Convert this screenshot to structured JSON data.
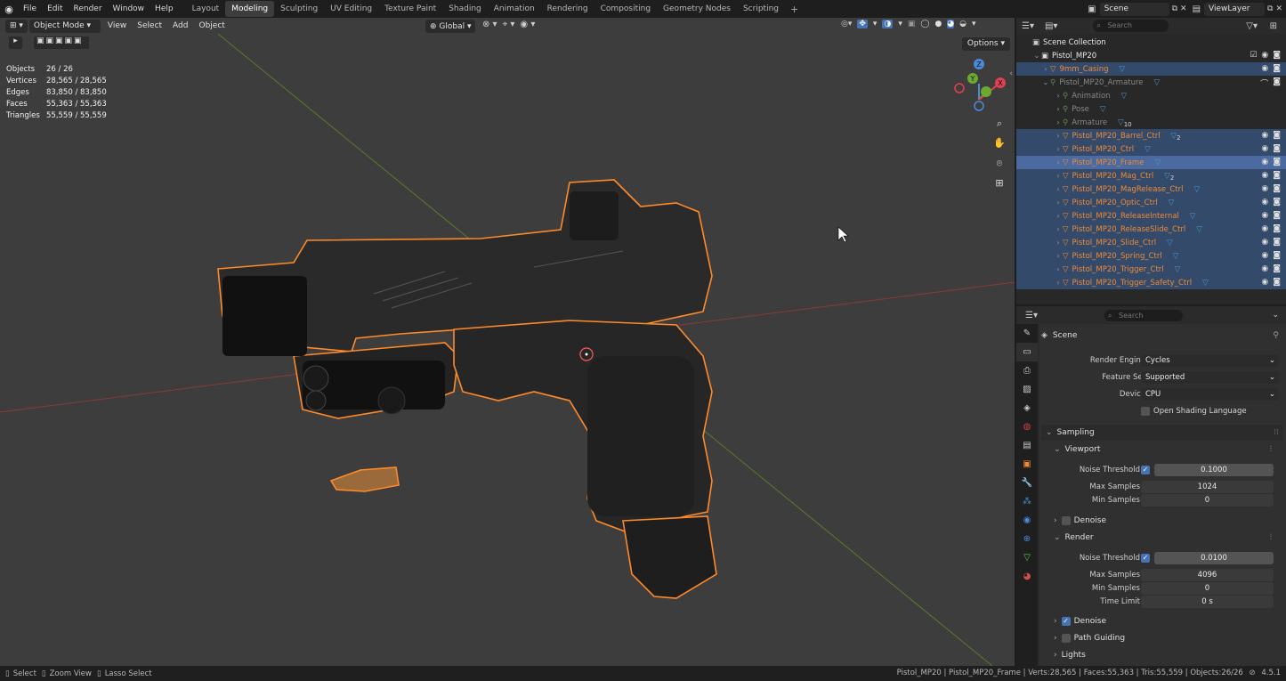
{
  "menu": [
    "File",
    "Edit",
    "Render",
    "Window",
    "Help"
  ],
  "workspaces": [
    {
      "label": "Layout",
      "active": false
    },
    {
      "label": "Modeling",
      "active": true
    },
    {
      "label": "Sculpting",
      "active": false
    },
    {
      "label": "UV Editing",
      "active": false
    },
    {
      "label": "Texture Paint",
      "active": false
    },
    {
      "label": "Shading",
      "active": false
    },
    {
      "label": "Animation",
      "active": false
    },
    {
      "label": "Rendering",
      "active": false
    },
    {
      "label": "Compositing",
      "active": false
    },
    {
      "label": "Geometry Nodes",
      "active": false
    },
    {
      "label": "Scripting",
      "active": false
    }
  ],
  "top_right": {
    "scene": "Scene",
    "view_layer": "ViewLayer"
  },
  "viewport": {
    "mode": "Object Mode",
    "menus": [
      "View",
      "Select",
      "Add",
      "Object"
    ],
    "orientation": "Global",
    "options": "Options",
    "gizmo": {
      "x": "X",
      "y": "Y",
      "z": "Z"
    }
  },
  "stats": [
    {
      "key": "Objects",
      "value": "26 / 26"
    },
    {
      "key": "Vertices",
      "value": "28,565 / 28,565"
    },
    {
      "key": "Edges",
      "value": "83,850 / 83,850"
    },
    {
      "key": "Faces",
      "value": "55,363 / 55,363"
    },
    {
      "key": "Triangles",
      "value": "55,559 / 55,559"
    }
  ],
  "outliner": {
    "search_placeholder": "Search",
    "root": "Scene Collection",
    "collection": "Pistol_MP20",
    "rows": [
      {
        "label": "9mm_Casing",
        "style": "orange",
        "sel": true,
        "indent": 2
      },
      {
        "label": "Pistol_MP20_Armature",
        "style": "dim",
        "sel": false,
        "indent": 2
      },
      {
        "label": "Animation",
        "style": "dim",
        "sel": false,
        "indent": 3
      },
      {
        "label": "Pose",
        "style": "dim",
        "sel": false,
        "indent": 3
      },
      {
        "label": "Armature",
        "style": "dim",
        "sel": false,
        "indent": 3,
        "badge": "10"
      },
      {
        "label": "Pistol_MP20_Barrel_Ctrl",
        "style": "orange",
        "sel": true,
        "indent": 3,
        "badge": "2"
      },
      {
        "label": "Pistol_MP20_Ctrl",
        "style": "orange",
        "sel": true,
        "indent": 3
      },
      {
        "label": "Pistol_MP20_Frame",
        "style": "orange",
        "sel": true,
        "active": true,
        "indent": 3
      },
      {
        "label": "Pistol_MP20_Mag_Ctrl",
        "style": "orange",
        "sel": true,
        "indent": 3,
        "badge": "2"
      },
      {
        "label": "Pistol_MP20_MagRelease_Ctrl",
        "style": "orange",
        "sel": true,
        "indent": 3
      },
      {
        "label": "Pistol_MP20_Optic_Ctrl",
        "style": "orange",
        "sel": true,
        "indent": 3
      },
      {
        "label": "Pistol_MP20_ReleaseInternal",
        "style": "orange",
        "sel": true,
        "indent": 3
      },
      {
        "label": "Pistol_MP20_ReleaseSlide_Ctrl",
        "style": "orange",
        "sel": true,
        "indent": 3
      },
      {
        "label": "Pistol_MP20_Slide_Ctrl",
        "style": "orange",
        "sel": true,
        "indent": 3
      },
      {
        "label": "Pistol_MP20_Spring_Ctrl",
        "style": "orange",
        "sel": true,
        "indent": 3
      },
      {
        "label": "Pistol_MP20_Trigger_Ctrl",
        "style": "orange",
        "sel": true,
        "indent": 3
      },
      {
        "label": "Pistol_MP20_Trigger_Safety_Ctrl",
        "style": "orange",
        "sel": true,
        "indent": 3
      }
    ]
  },
  "properties": {
    "search_placeholder": "Search",
    "context": "Scene",
    "render_engine_label": "Render Engine",
    "render_engine": "Cycles",
    "feature_set_label": "Feature Set",
    "feature_set": "Supported",
    "device_label": "Device",
    "device": "CPU",
    "osl_label": "Open Shading Language",
    "sampling": "Sampling",
    "viewport": "Viewport",
    "vp_noise_label": "Noise Threshold",
    "vp_noise": "0.1000",
    "vp_max_label": "Max Samples",
    "vp_max": "1024",
    "vp_min_label": "Min Samples",
    "vp_min": "0",
    "vp_denoise": "Denoise",
    "render": "Render",
    "r_noise_label": "Noise Threshold",
    "r_noise": "0.0100",
    "r_max_label": "Max Samples",
    "r_max": "4096",
    "r_min_label": "Min Samples",
    "r_min": "0",
    "r_time_label": "Time Limit",
    "r_time": "0 s",
    "r_denoise": "Denoise",
    "path_guiding": "Path Guiding",
    "lights": "Lights"
  },
  "status": {
    "select": "Select",
    "zoom": "Zoom View",
    "lasso": "Lasso Select",
    "info": "Pistol_MP20 | Pistol_MP20_Frame | Verts:28,565 | Faces:55,363 | Tris:55,559 | Objects:26/26",
    "version": "4.5.1"
  },
  "colors": {
    "selection_orange": "#f08a36",
    "active_blue": "#4a6aa0",
    "selected_row": "#334a6b",
    "checkbox_blue": "#4772b3"
  }
}
